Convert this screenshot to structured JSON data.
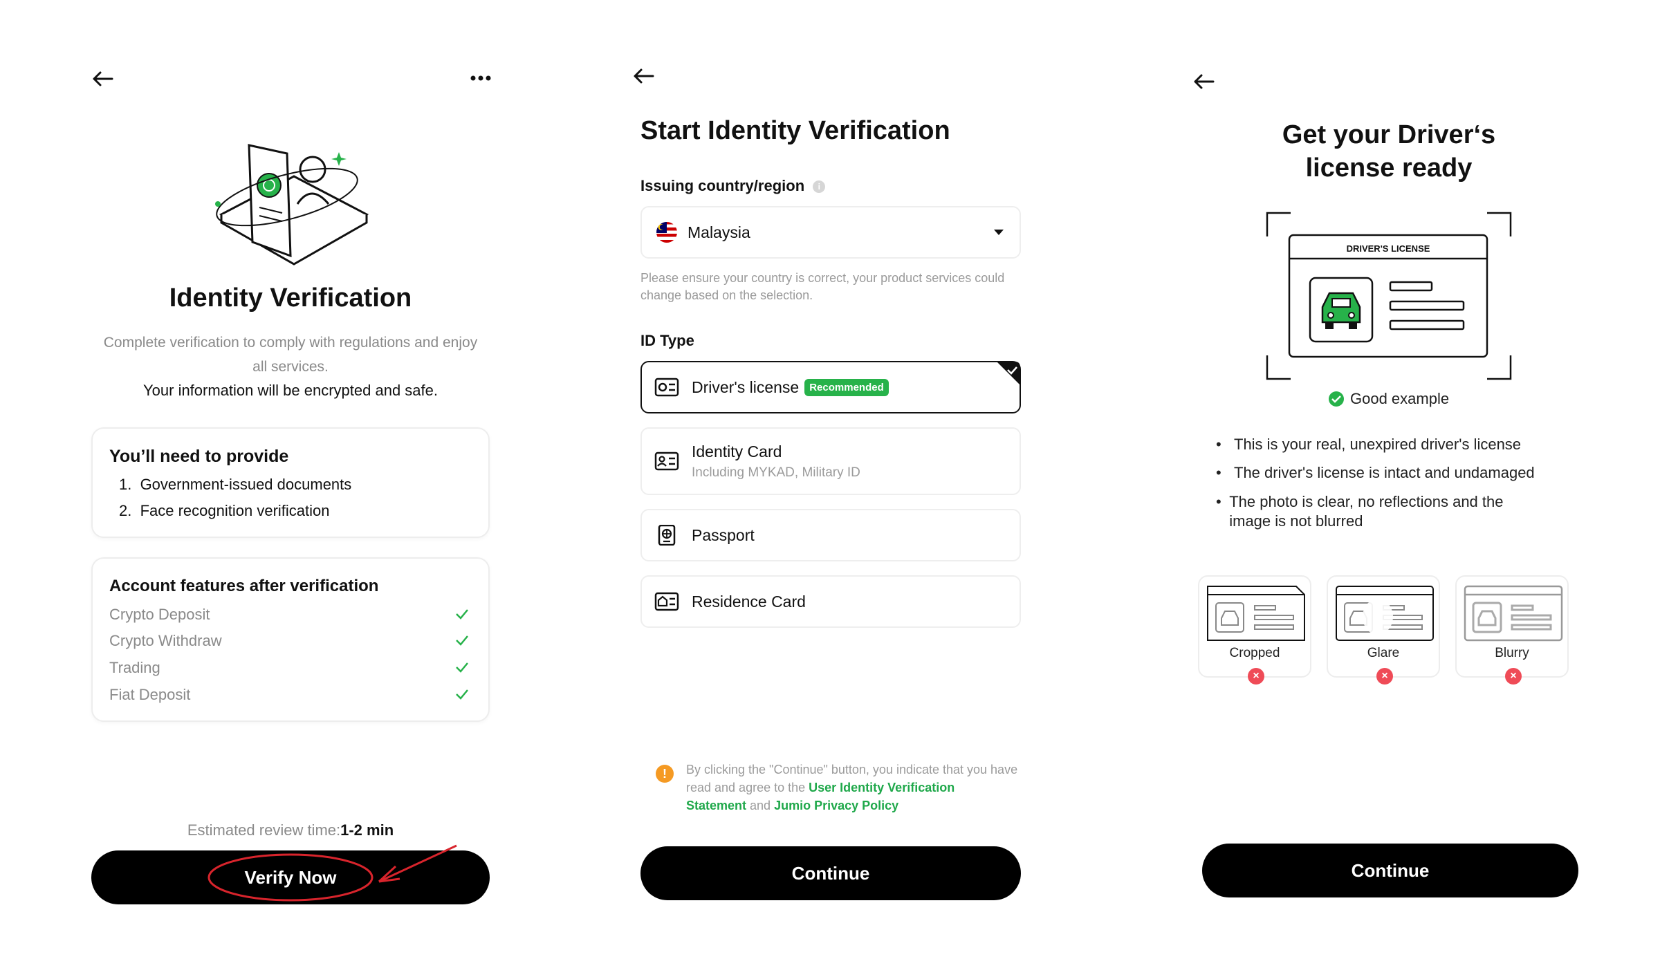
{
  "screen1": {
    "title": "Identity Verification",
    "description": "Complete verification to comply with regulations and enjoy all services.",
    "security_note": "Your information will be encrypted and safe.",
    "provide_card": {
      "title": "You’ll need to provide",
      "items": [
        "1.  Government-issued documents",
        "2.  Face recognition verification"
      ]
    },
    "features_card": {
      "title": "Account features after verification",
      "items": [
        "Crypto Deposit",
        "Crypto Withdraw",
        "Trading",
        "Fiat Deposit"
      ]
    },
    "review_label": "Estimated review time:",
    "review_value": "1-2 min",
    "verify_button": "Verify Now"
  },
  "screen2": {
    "title": "Start Identity Verification",
    "country_label": "Issuing country/region",
    "country_value": "Malaysia",
    "country_hint": "Please ensure your country is correct, your product services could change based on the selection.",
    "id_type_label": "ID Type",
    "id_options": [
      {
        "label": "Driver's license",
        "badge": "Recommended"
      },
      {
        "label": "Identity Card",
        "sub": "Including MYKAD, Military ID"
      },
      {
        "label": "Passport"
      },
      {
        "label": "Residence Card"
      }
    ],
    "consent_text_1": "By clicking the \"Continue\" button, you indicate that you have read and agree to the ",
    "consent_link_1": "User Identity Verification Statement",
    "consent_and": " and ",
    "consent_link_2": "Jumio Privacy Policy",
    "continue_button": "Continue"
  },
  "screen3": {
    "title_line1": "Get your Driver‘s",
    "title_line2": "license ready",
    "license_header": "DRIVER'S LICENSE",
    "good_example": "Good example",
    "bullets": [
      "This is your real, unexpired driver's license",
      "The driver's license is intact and undamaged",
      "The photo is clear, no reflections and the image is not blurred"
    ],
    "bad_examples": [
      "Cropped",
      "Glare",
      "Blurry"
    ],
    "continue_button": "Continue"
  },
  "colors": {
    "accent_green": "#27b24a",
    "error_red": "#ef4b57",
    "annotation_red": "#d8242c",
    "warning_orange": "#f59a23"
  }
}
